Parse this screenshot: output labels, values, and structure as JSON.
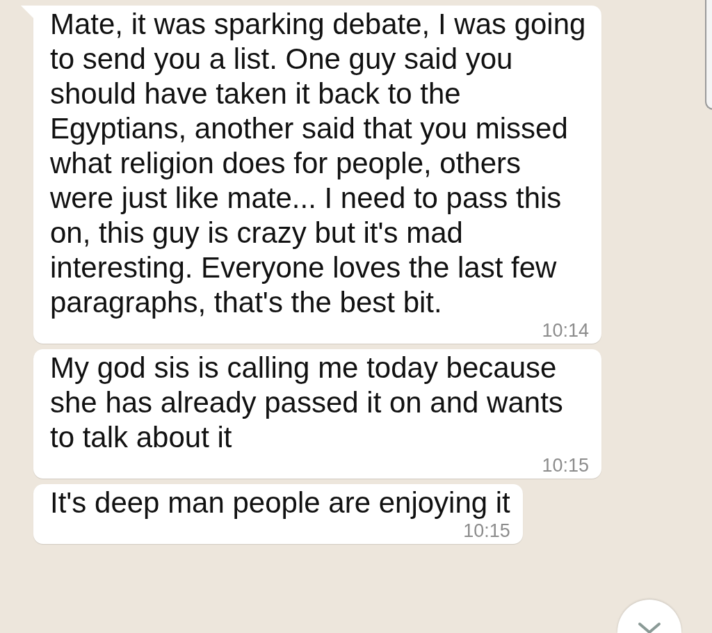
{
  "messages": [
    {
      "text": "Mate, it was sparking debate, I was going to send you a list. One guy said you should have taken it back to the Egyptians, another said that you missed what religion does for people, others were just like mate... I need to pass this on, this guy is crazy but it's mad interesting. Everyone loves the last few paragraphs, that's the best bit.",
      "time": "10:14",
      "tail": true
    },
    {
      "text": "My god sis is calling me today because she has already passed it on and wants to talk about it",
      "time": "10:15",
      "tail": false
    },
    {
      "text": "It's deep man people are enjoying it",
      "time": "10:15",
      "tail": false
    }
  ]
}
